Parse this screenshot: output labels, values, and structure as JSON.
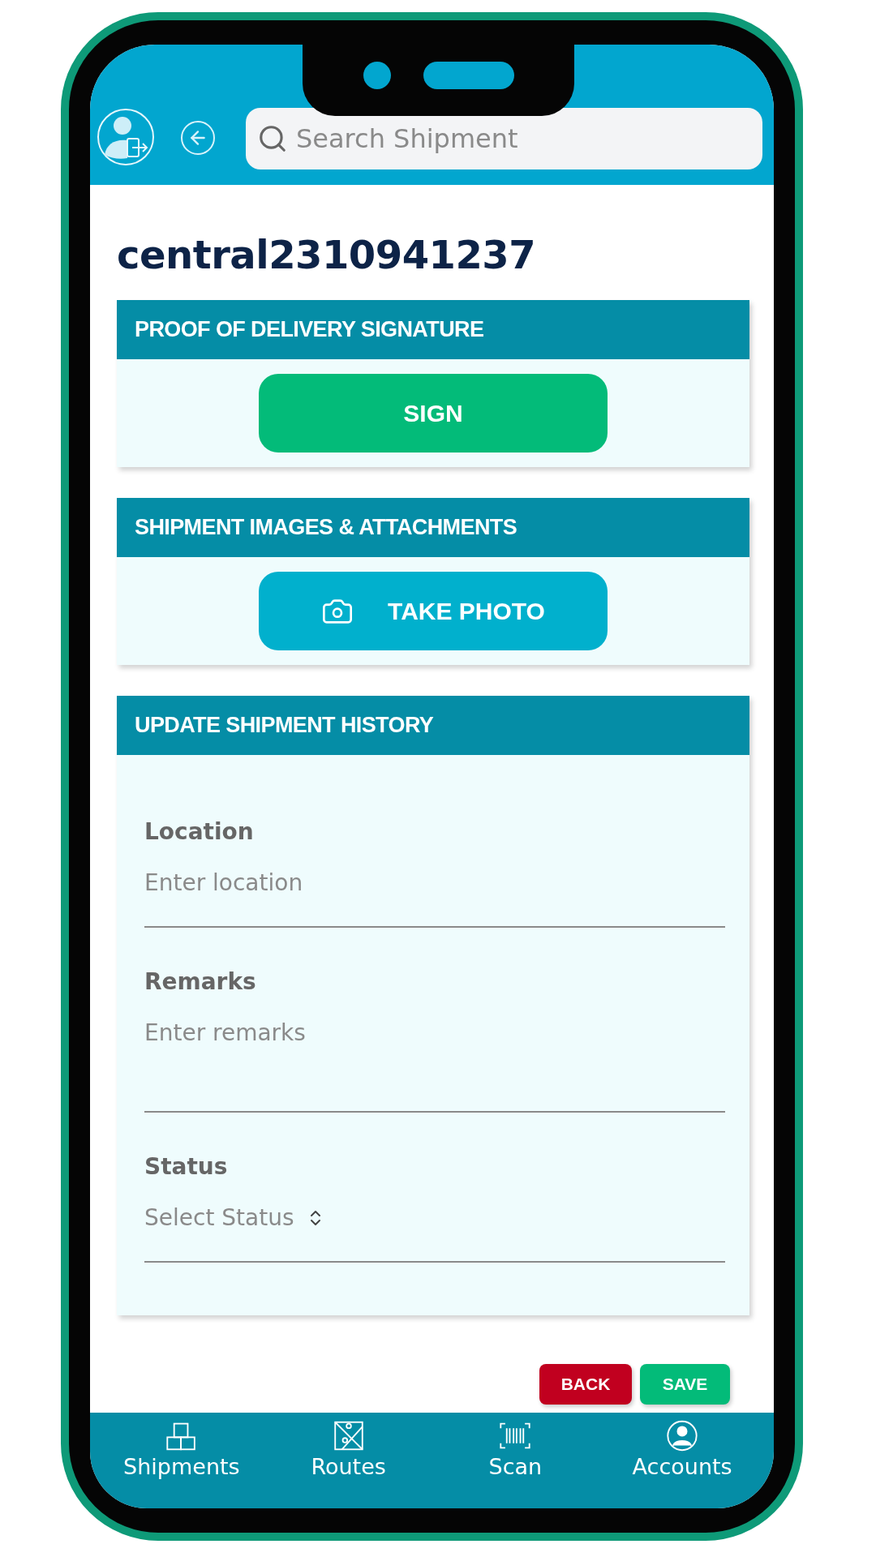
{
  "header": {
    "search": {
      "placeholder": "Search Shipment"
    }
  },
  "shipment_id": "central2310941237",
  "sections": [
    {
      "title": "PROOF OF DELIVERY SIGNATURE",
      "button": {
        "label": "SIGN",
        "kind": "sign"
      }
    },
    {
      "title": "SHIPMENT IMAGES & ATTACHMENTS",
      "button": {
        "label": "TAKE PHOTO",
        "kind": "photo"
      }
    }
  ],
  "history": {
    "title": "UPDATE SHIPMENT HISTORY",
    "fields": [
      {
        "label": "Location",
        "placeholder": "Enter location",
        "kind": "text"
      },
      {
        "label": "Remarks",
        "placeholder": "Enter remarks",
        "kind": "textarea"
      },
      {
        "label": "Status",
        "placeholder": "Select Status",
        "kind": "select"
      }
    ]
  },
  "actions": [
    {
      "label": "BACK",
      "kind": "back"
    },
    {
      "label": "SAVE",
      "kind": "save"
    }
  ],
  "nav": [
    {
      "label": "Shipments",
      "kind": "boxes"
    },
    {
      "label": "Routes",
      "kind": "map"
    },
    {
      "label": "Scan",
      "kind": "barcode"
    },
    {
      "label": "Accounts",
      "kind": "user"
    }
  ]
}
